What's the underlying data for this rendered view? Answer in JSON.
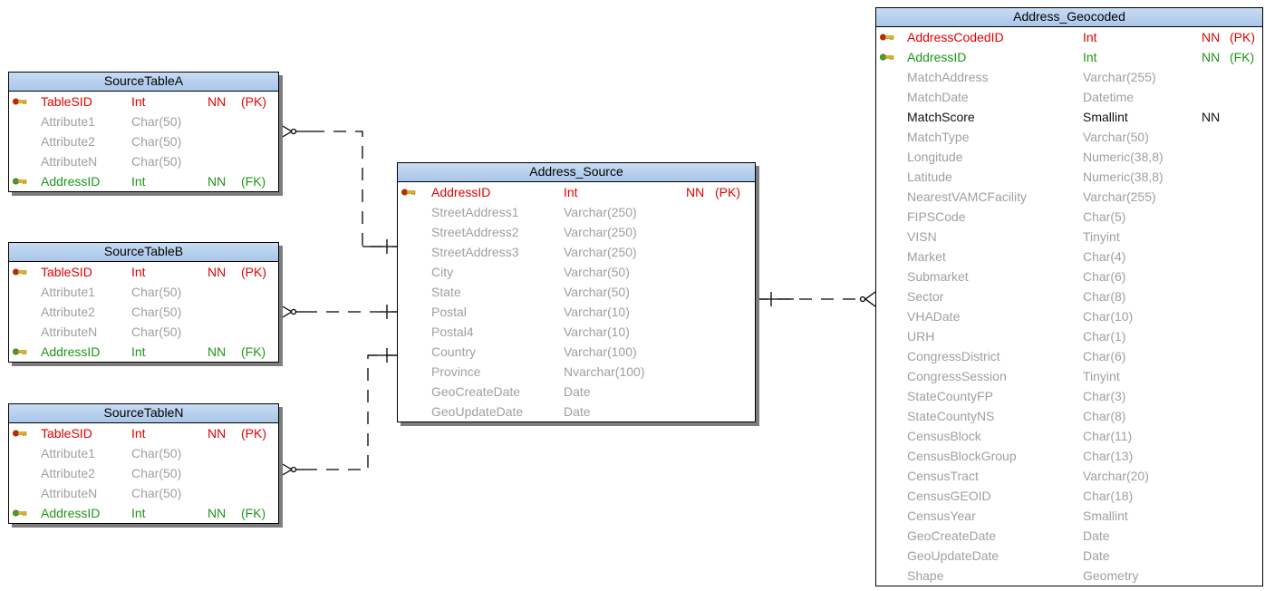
{
  "tables": [
    {
      "id": "source-table-a",
      "name": "SourceTableA",
      "columns": [
        {
          "name": "TableSID",
          "type": "Int",
          "nn": "NN",
          "key": "(PK)",
          "role": "pk"
        },
        {
          "name": "Attribute1",
          "type": "Char(50)",
          "nn": "",
          "key": "",
          "role": "attr"
        },
        {
          "name": "Attribute2",
          "type": "Char(50)",
          "nn": "",
          "key": "",
          "role": "attr"
        },
        {
          "name": "AttributeN",
          "type": "Char(50)",
          "nn": "",
          "key": "",
          "role": "attr"
        },
        {
          "name": "AddressID",
          "type": "Int",
          "nn": "NN",
          "key": "(FK)",
          "role": "fk"
        }
      ]
    },
    {
      "id": "source-table-b",
      "name": "SourceTableB",
      "columns": [
        {
          "name": "TableSID",
          "type": "Int",
          "nn": "NN",
          "key": "(PK)",
          "role": "pk"
        },
        {
          "name": "Attribute1",
          "type": "Char(50)",
          "nn": "",
          "key": "",
          "role": "attr"
        },
        {
          "name": "Attribute2",
          "type": "Char(50)",
          "nn": "",
          "key": "",
          "role": "attr"
        },
        {
          "name": "AttributeN",
          "type": "Char(50)",
          "nn": "",
          "key": "",
          "role": "attr"
        },
        {
          "name": "AddressID",
          "type": "Int",
          "nn": "NN",
          "key": "(FK)",
          "role": "fk"
        }
      ]
    },
    {
      "id": "source-table-n",
      "name": "SourceTableN",
      "columns": [
        {
          "name": "TableSID",
          "type": "Int",
          "nn": "NN",
          "key": "(PK)",
          "role": "pk"
        },
        {
          "name": "Attribute1",
          "type": "Char(50)",
          "nn": "",
          "key": "",
          "role": "attr"
        },
        {
          "name": "Attribute2",
          "type": "Char(50)",
          "nn": "",
          "key": "",
          "role": "attr"
        },
        {
          "name": "AttributeN",
          "type": "Char(50)",
          "nn": "",
          "key": "",
          "role": "attr"
        },
        {
          "name": "AddressID",
          "type": "Int",
          "nn": "NN",
          "key": "(FK)",
          "role": "fk"
        }
      ]
    },
    {
      "id": "address-source",
      "name": "Address_Source",
      "columns": [
        {
          "name": "AddressID",
          "type": "Int",
          "nn": "NN",
          "key": "(PK)",
          "role": "pk"
        },
        {
          "name": "StreetAddress1",
          "type": "Varchar(250)",
          "nn": "",
          "key": "",
          "role": "attr"
        },
        {
          "name": "StreetAddress2",
          "type": "Varchar(250)",
          "nn": "",
          "key": "",
          "role": "attr"
        },
        {
          "name": "StreetAddress3",
          "type": "Varchar(250)",
          "nn": "",
          "key": "",
          "role": "attr"
        },
        {
          "name": "City",
          "type": "Varchar(50)",
          "nn": "",
          "key": "",
          "role": "attr"
        },
        {
          "name": "State",
          "type": "Varchar(50)",
          "nn": "",
          "key": "",
          "role": "attr"
        },
        {
          "name": "Postal",
          "type": "Varchar(10)",
          "nn": "",
          "key": "",
          "role": "attr"
        },
        {
          "name": "Postal4",
          "type": "Varchar(10)",
          "nn": "",
          "key": "",
          "role": "attr"
        },
        {
          "name": "Country",
          "type": "Varchar(100)",
          "nn": "",
          "key": "",
          "role": "attr"
        },
        {
          "name": "Province",
          "type": "Nvarchar(100)",
          "nn": "",
          "key": "",
          "role": "attr"
        },
        {
          "name": "GeoCreateDate",
          "type": "Date",
          "nn": "",
          "key": "",
          "role": "attr"
        },
        {
          "name": "GeoUpdateDate",
          "type": "Date",
          "nn": "",
          "key": "",
          "role": "attr"
        }
      ]
    },
    {
      "id": "address-geocoded",
      "name": "Address_Geocoded",
      "columns": [
        {
          "name": "AddressCodedID",
          "type": "Int",
          "nn": "NN",
          "key": "(PK)",
          "role": "pk"
        },
        {
          "name": "AddressID",
          "type": "Int",
          "nn": "NN",
          "key": "(FK)",
          "role": "fk"
        },
        {
          "name": "MatchAddress",
          "type": "Varchar(255)",
          "nn": "",
          "key": "",
          "role": "attr"
        },
        {
          "name": "MatchDate",
          "type": "Datetime",
          "nn": "",
          "key": "",
          "role": "attr"
        },
        {
          "name": "MatchScore",
          "type": "Smallint",
          "nn": "NN",
          "key": "",
          "role": "nn"
        },
        {
          "name": "MatchType",
          "type": "Varchar(50)",
          "nn": "",
          "key": "",
          "role": "attr"
        },
        {
          "name": "Longitude",
          "type": "Numeric(38,8)",
          "nn": "",
          "key": "",
          "role": "attr"
        },
        {
          "name": "Latitude",
          "type": "Numeric(38,8)",
          "nn": "",
          "key": "",
          "role": "attr"
        },
        {
          "name": "NearestVAMCFacility",
          "type": "Varchar(255)",
          "nn": "",
          "key": "",
          "role": "attr"
        },
        {
          "name": "FIPSCode",
          "type": "Char(5)",
          "nn": "",
          "key": "",
          "role": "attr"
        },
        {
          "name": "VISN",
          "type": "Tinyint",
          "nn": "",
          "key": "",
          "role": "attr"
        },
        {
          "name": "Market",
          "type": "Char(4)",
          "nn": "",
          "key": "",
          "role": "attr"
        },
        {
          "name": "Submarket",
          "type": "Char(6)",
          "nn": "",
          "key": "",
          "role": "attr"
        },
        {
          "name": "Sector",
          "type": "Char(8)",
          "nn": "",
          "key": "",
          "role": "attr"
        },
        {
          "name": "VHADate",
          "type": "Char(10)",
          "nn": "",
          "key": "",
          "role": "attr"
        },
        {
          "name": "URH",
          "type": "Char(1)",
          "nn": "",
          "key": "",
          "role": "attr"
        },
        {
          "name": "CongressDistrict",
          "type": "Char(6)",
          "nn": "",
          "key": "",
          "role": "attr"
        },
        {
          "name": "CongressSession",
          "type": "Tinyint",
          "nn": "",
          "key": "",
          "role": "attr"
        },
        {
          "name": "StateCountyFP",
          "type": "Char(3)",
          "nn": "",
          "key": "",
          "role": "attr"
        },
        {
          "name": "StateCountyNS",
          "type": "Char(8)",
          "nn": "",
          "key": "",
          "role": "attr"
        },
        {
          "name": "CensusBlock",
          "type": "Char(11)",
          "nn": "",
          "key": "",
          "role": "attr"
        },
        {
          "name": "CensusBlockGroup",
          "type": "Char(13)",
          "nn": "",
          "key": "",
          "role": "attr"
        },
        {
          "name": "CensusTract",
          "type": "Varchar(20)",
          "nn": "",
          "key": "",
          "role": "attr"
        },
        {
          "name": "CensusGEOID",
          "type": "Char(18)",
          "nn": "",
          "key": "",
          "role": "attr"
        },
        {
          "name": "CensusYear",
          "type": "Smallint",
          "nn": "",
          "key": "",
          "role": "attr"
        },
        {
          "name": "GeoCreateDate",
          "type": "Date",
          "nn": "",
          "key": "",
          "role": "attr"
        },
        {
          "name": "GeoUpdateDate",
          "type": "Date",
          "nn": "",
          "key": "",
          "role": "attr"
        },
        {
          "name": "Shape",
          "type": "Geometry",
          "nn": "",
          "key": "",
          "role": "attr"
        }
      ]
    }
  ],
  "relationships": [
    {
      "from": "source-table-a",
      "to": "address-source",
      "type": "many-to-one"
    },
    {
      "from": "source-table-b",
      "to": "address-source",
      "type": "many-to-one"
    },
    {
      "from": "source-table-n",
      "to": "address-source",
      "type": "many-to-one"
    },
    {
      "from": "address-geocoded",
      "to": "address-source",
      "type": "many-to-one"
    }
  ],
  "colors": {
    "pk": "#e20000",
    "fk": "#1e9618",
    "attribute": "#a0a0a0",
    "not_null": "#111111",
    "header": "#b7d0ee"
  },
  "icons": {
    "pk": "primary-key-icon",
    "fk": "foreign-key-icon"
  }
}
